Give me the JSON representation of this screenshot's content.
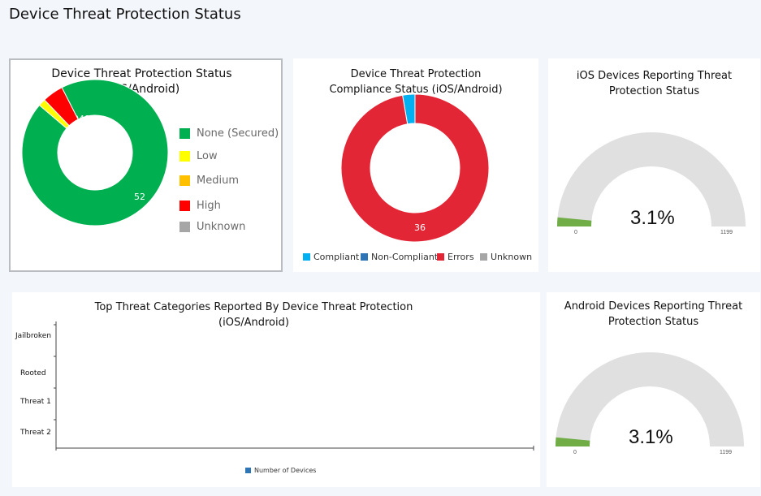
{
  "page": {
    "title": "Device Threat Protection Status"
  },
  "status_card": {
    "title_line1": "Device Threat Protection Status",
    "title_line2": "(iOS/Android)",
    "legend": [
      {
        "label": "None (Secured)",
        "color": "#00b050"
      },
      {
        "label": "Low",
        "color": "#ffff00"
      },
      {
        "label": "Medium",
        "color": "#ffc000"
      },
      {
        "label": "High",
        "color": "#ff0000"
      },
      {
        "label": "Unknown",
        "color": "#a6a6a6"
      }
    ]
  },
  "compliance_card": {
    "title_line1": "Device Threat Protection",
    "title_line2": "Compliance Status (iOS/Android)",
    "legend": [
      {
        "label": "Compliant",
        "color": "#00b0f0"
      },
      {
        "label": "Non-Compliant",
        "color": "#2e75b6"
      },
      {
        "label": "Errors",
        "color": "#e32636"
      },
      {
        "label": "Unknown",
        "color": "#a6a6a6"
      }
    ]
  },
  "ios_card": {
    "title_line1": "iOS Devices Reporting Threat",
    "title_line2": "Protection Status",
    "value_text": "3.1%",
    "min_label": "0",
    "max_label": "1199"
  },
  "threats_card": {
    "title_line1": "Top Threat Categories Reported By Device Threat Protection",
    "title_line2": "(iOS/Android)",
    "legend_label": "Number of Devices",
    "legend_color": "#2e75b6"
  },
  "android_card": {
    "title_line1": "Android Devices Reporting Threat",
    "title_line2": "Protection Status",
    "value_text": "3.1%",
    "min_label": "0",
    "max_label": "1199"
  },
  "chart_data": [
    {
      "type": "pie",
      "title": "Device Threat Protection Status (iOS/Android)",
      "categories": [
        "None (Secured)",
        "Low",
        "Medium",
        "High",
        "Unknown"
      ],
      "values": [
        1048,
        18,
        0,
        52,
        0
      ],
      "data_labels": [
        "1048",
        "",
        "",
        "52",
        ""
      ],
      "colors": [
        "#00b050",
        "#ffff00",
        "#ffc000",
        "#ff0000",
        "#a6a6a6"
      ],
      "donut": true,
      "legend": "right"
    },
    {
      "type": "pie",
      "title": "Device Threat Protection Compliance Status (iOS/Android)",
      "categories": [
        "Compliant",
        "Non-Compliant",
        "Errors",
        "Unknown"
      ],
      "values": [
        1,
        0,
        36,
        0
      ],
      "data_labels": [
        "",
        "",
        "36",
        ""
      ],
      "colors": [
        "#00b0f0",
        "#2e75b6",
        "#e32636",
        "#a6a6a6"
      ],
      "donut": true,
      "legend": "bottom"
    },
    {
      "type": "bar",
      "title": "iOS Devices Reporting Threat Protection Status",
      "value_percent": 3.1,
      "min": 0,
      "max": 1199,
      "fill_color": "#70ad47",
      "track_color": "#e0e0e0"
    },
    {
      "type": "bar",
      "title": "Top Threat Categories Reported By Device Threat Protection (iOS/Android)",
      "orientation": "horizontal",
      "categories": [
        "Jailbroken",
        "Rooted",
        "Threat 1",
        "Threat 2"
      ],
      "series": [
        {
          "name": "Number of Devices",
          "values": [
            0,
            0,
            0,
            0
          ]
        }
      ],
      "legend": "bottom"
    },
    {
      "type": "bar",
      "title": "Android Devices Reporting Threat Protection Status",
      "value_percent": 3.1,
      "min": 0,
      "max": 1199,
      "fill_color": "#70ad47",
      "track_color": "#e0e0e0"
    }
  ]
}
